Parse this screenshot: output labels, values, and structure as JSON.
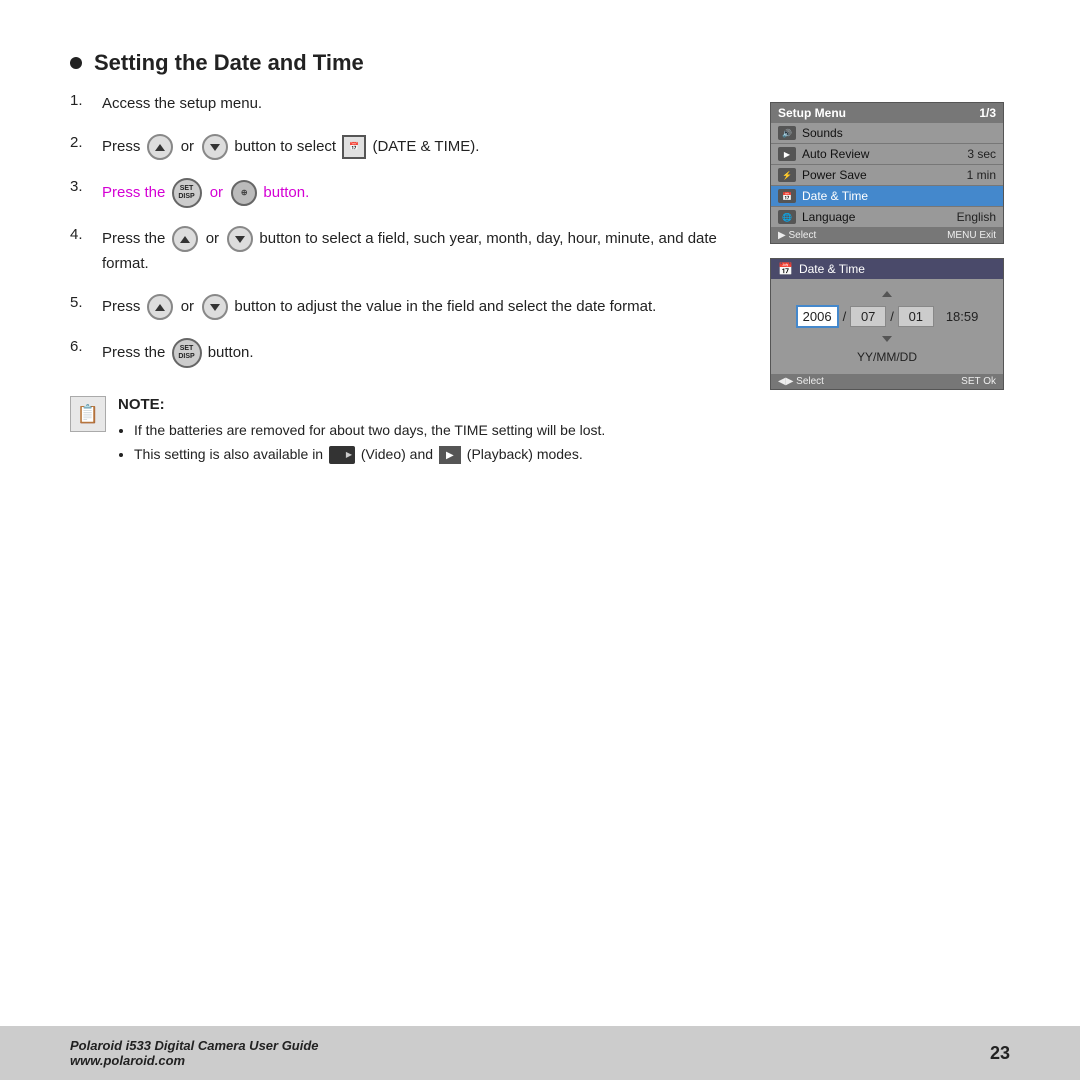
{
  "page": {
    "title": "Setting the Date and Time",
    "steps": [
      {
        "num": "1.",
        "text": "Access the setup menu."
      },
      {
        "num": "2.",
        "text_parts": [
          "Press",
          "or",
          "button to select",
          "(DATE & TIME)."
        ]
      },
      {
        "num": "3.",
        "text_parts": [
          "Press the",
          "or",
          "button."
        ],
        "highlight": true
      },
      {
        "num": "4.",
        "text": "Press the",
        "text2": "or",
        "text3": "button to select a field, such year, month, day, hour, minute, and date format."
      },
      {
        "num": "5.",
        "text": "Press",
        "text2": "or",
        "text3": "button to adjust the value in the field and select the date format."
      },
      {
        "num": "6.",
        "text": "Press  the",
        "text2": "button."
      }
    ],
    "setupMenu": {
      "header_label": "Setup Menu",
      "header_page": "1/3",
      "rows": [
        {
          "icon": "🔊",
          "label": "Sounds",
          "value": ""
        },
        {
          "icon": "▶",
          "label": "Auto Review",
          "value": "3 sec"
        },
        {
          "icon": "⚡",
          "label": "Power Save",
          "value": "1 min"
        },
        {
          "icon": "📅",
          "label": "Date & Time",
          "value": "",
          "selected": true
        },
        {
          "icon": "🌐",
          "label": "Language",
          "value": "English"
        }
      ],
      "footer_select": "▶ Select",
      "footer_exit": "MENU Exit"
    },
    "dateTimePanel": {
      "header_label": "Date & Time",
      "year": "2006",
      "separator1": "/",
      "month": "07",
      "separator2": "/",
      "day": "01",
      "time": "18:59",
      "format": "YY/MM/DD",
      "footer_select": "◀▶ Select",
      "footer_ok": "SET Ok"
    },
    "note": {
      "title": "NOTE:",
      "items": [
        "If the batteries are removed for about two days, the TIME setting will be lost.",
        "This setting is also available in  (Video) and  (Playback) modes."
      ]
    },
    "footer": {
      "brand": "Polaroid i533 Digital Camera User Guide",
      "website": "www.polaroid.com",
      "page_num": "23"
    }
  }
}
